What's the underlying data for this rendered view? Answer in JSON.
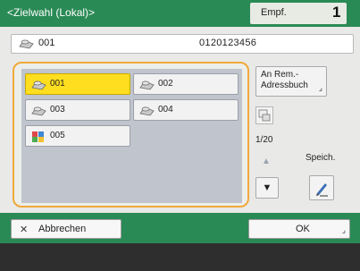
{
  "header": {
    "title": "<Zielwahl (Lokal)>",
    "recipients_label": "Empf.",
    "recipients_count": "1"
  },
  "destination": {
    "code": "001",
    "number": "0120123456"
  },
  "grid": {
    "items": [
      {
        "label": "001",
        "icon": "fax-icon",
        "selected": true
      },
      {
        "label": "002",
        "icon": "fax-icon",
        "selected": false
      },
      {
        "label": "003",
        "icon": "fax-icon",
        "selected": false
      },
      {
        "label": "004",
        "icon": "fax-icon",
        "selected": false
      },
      {
        "label": "005",
        "icon": "group-icon",
        "selected": false
      }
    ]
  },
  "side": {
    "remote_addressbook_label": "An Rem.-Adressbuch",
    "page_indicator": "1/20",
    "save_label": "Speich."
  },
  "footer": {
    "cancel_label": "Abbrechen",
    "ok_label": "OK"
  },
  "colors": {
    "header_green": "#2a8a55",
    "selected_yellow": "#ffde1f",
    "focus_orange": "#f0a93a"
  }
}
